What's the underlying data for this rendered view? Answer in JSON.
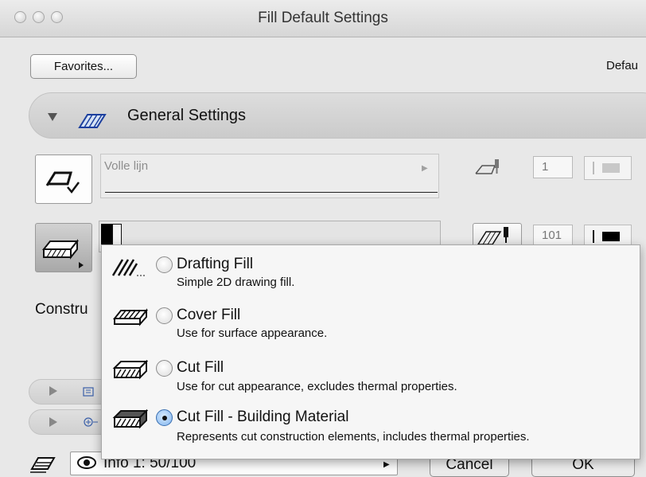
{
  "window": {
    "title": "Fill Default Settings"
  },
  "toolbar": {
    "favorites_label": "Favorites...",
    "default_label": "Defau"
  },
  "general": {
    "title": "General Settings"
  },
  "line_type": {
    "name": "Volle lijn",
    "pen_value": "1"
  },
  "fill_type": {
    "pen_value": "101"
  },
  "construction": {
    "label": "Constru"
  },
  "fill_menu": {
    "options": [
      {
        "title": "Drafting Fill",
        "description": "Simple 2D drawing fill.",
        "selected": false,
        "icon": "drafting-fill-icon"
      },
      {
        "title": "Cover Fill",
        "description": "Use for surface appearance.",
        "selected": false,
        "icon": "cover-fill-icon"
      },
      {
        "title": "Cut Fill",
        "description": "Use for cut appearance, excludes thermal properties.",
        "selected": false,
        "icon": "cut-fill-icon"
      },
      {
        "title": "Cut Fill - Building Material",
        "description": "Represents cut construction elements, includes thermal properties.",
        "selected": true,
        "icon": "building-material-icon"
      }
    ]
  },
  "bottom": {
    "layer_text": "Info 1: 50/100",
    "cancel_label": "Cancel",
    "ok_label": "OK"
  },
  "colors": {
    "selection_blue": "#5b9ae8",
    "window_bg": "#e8e8e8"
  }
}
